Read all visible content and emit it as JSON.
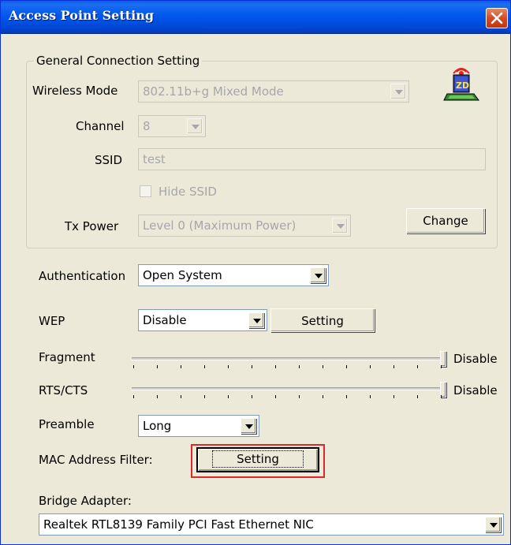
{
  "window": {
    "title": "Access Point Setting",
    "close_icon": "close-icon"
  },
  "general": {
    "legend": "General Connection Setting",
    "wireless_mode_label": "Wireless Mode",
    "wireless_mode_value": "802.11b+g Mixed Mode",
    "channel_label": "Channel",
    "channel_value": "8",
    "ssid_label": "SSID",
    "ssid_value": "test",
    "hide_ssid_label": "Hide SSID",
    "hide_ssid_checked": false,
    "tx_power_label": "Tx Power",
    "tx_power_value": "Level 0 (Maximum Power)",
    "change_button": "Change",
    "app_icon": "zd-wireless-icon"
  },
  "security": {
    "authentication_label": "Authentication",
    "authentication_value": "Open System",
    "wep_label": "WEP",
    "wep_value": "Disable",
    "wep_setting_button": "Setting"
  },
  "advanced": {
    "fragment_label": "Fragment",
    "fragment_value": "Disable",
    "rts_label": "RTS/CTS",
    "rts_value": "Disable",
    "preamble_label": "Preamble",
    "preamble_value": "Long",
    "mac_filter_label": "MAC Address Filter:",
    "mac_filter_button": "Setting",
    "bridge_label": "Bridge Adapter:",
    "bridge_value": "Realtek RTL8139 Family PCI Fast Ethernet NIC"
  },
  "colors": {
    "titlebar": "#0058ee",
    "dialog_bg": "#ece9d8",
    "highlight": "#e2272b"
  }
}
